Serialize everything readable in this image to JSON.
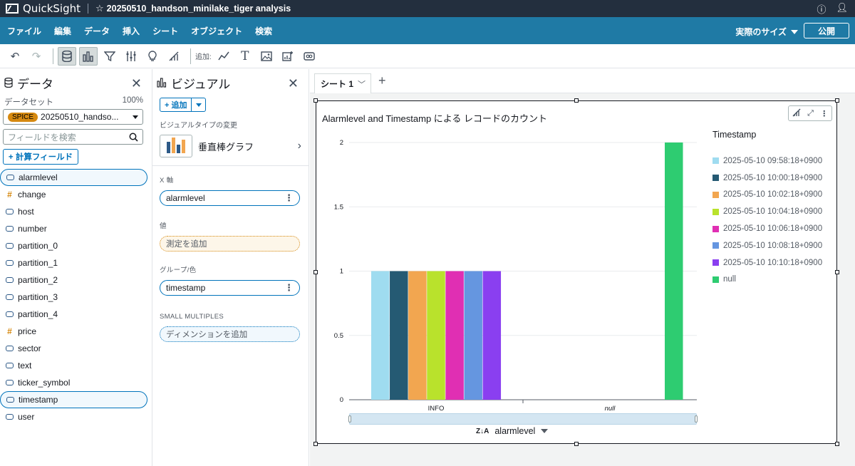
{
  "app": {
    "name": "QuickSight",
    "analysis_title": "20250510_handson_minilake_tiger analysis"
  },
  "menu": {
    "items": [
      "ファイル",
      "編集",
      "データ",
      "挿入",
      "シート",
      "オブジェクト",
      "検索"
    ],
    "size_label": "実際のサイズ",
    "publish_label": "公開"
  },
  "toolbar": {
    "add_label": "追加:"
  },
  "data_panel": {
    "title": "データ",
    "dataset_label": "データセット",
    "dataset_percent": "100%",
    "spice_badge": "SPICE",
    "dataset_name": "20250510_handso...",
    "search_placeholder": "フィールドを検索",
    "calc_field_label": "+ 計算フィールド",
    "fields": [
      {
        "name": "alarmlevel",
        "type": "dimension",
        "selected": true
      },
      {
        "name": "change",
        "type": "measure",
        "selected": false
      },
      {
        "name": "host",
        "type": "dimension",
        "selected": false
      },
      {
        "name": "number",
        "type": "dimension",
        "selected": false
      },
      {
        "name": "partition_0",
        "type": "dimension",
        "selected": false
      },
      {
        "name": "partition_1",
        "type": "dimension",
        "selected": false
      },
      {
        "name": "partition_2",
        "type": "dimension",
        "selected": false
      },
      {
        "name": "partition_3",
        "type": "dimension",
        "selected": false
      },
      {
        "name": "partition_4",
        "type": "dimension",
        "selected": false
      },
      {
        "name": "price",
        "type": "measure",
        "selected": false
      },
      {
        "name": "sector",
        "type": "dimension",
        "selected": false
      },
      {
        "name": "text",
        "type": "dimension",
        "selected": false
      },
      {
        "name": "ticker_symbol",
        "type": "dimension",
        "selected": false
      },
      {
        "name": "timestamp",
        "type": "dimension",
        "selected": true
      },
      {
        "name": "user",
        "type": "dimension",
        "selected": false
      }
    ]
  },
  "visual_panel": {
    "title": "ビジュアル",
    "add_label": "+ 追加",
    "change_type_label": "ビジュアルタイプの変更",
    "visual_type": "垂直棒グラフ",
    "x_axis_label": "X 軸",
    "x_axis_field": "alarmlevel",
    "value_label": "値",
    "value_placeholder": "測定を追加",
    "group_label": "グループ/色",
    "group_field": "timestamp",
    "small_multiples_label": "SMALL MULTIPLES",
    "small_multiples_placeholder": "ディメンションを追加"
  },
  "sheet": {
    "tab_label": "シート 1"
  },
  "visual": {
    "title": "Alarmlevel and Timestamp による レコードのカウント",
    "x_field_label": "alarmlevel"
  },
  "chart_data": {
    "type": "bar",
    "title": "Alarmlevel and Timestamp による レコードのカウント",
    "xlabel": "alarmlevel",
    "ylabel": "",
    "ylim": [
      0,
      2
    ],
    "yticks": [
      "0",
      "0.5",
      "1",
      "1.5",
      "2"
    ],
    "categories": [
      "INFO",
      "null"
    ],
    "legend_title": "Timestamp",
    "legend_position": "right",
    "series": [
      {
        "name": "2025-05-10 09:58:18+0900",
        "color": "#9fdcf0",
        "values": [
          1,
          0
        ]
      },
      {
        "name": "2025-05-10 10:00:18+0900",
        "color": "#255a73",
        "values": [
          1,
          0
        ]
      },
      {
        "name": "2025-05-10 10:02:18+0900",
        "color": "#f2a650",
        "values": [
          1,
          0
        ]
      },
      {
        "name": "2025-05-10 10:04:18+0900",
        "color": "#b9e22c",
        "values": [
          1,
          0
        ]
      },
      {
        "name": "2025-05-10 10:06:18+0900",
        "color": "#e02fb3",
        "values": [
          1,
          0
        ]
      },
      {
        "name": "2025-05-10 10:08:18+0900",
        "color": "#6596e0",
        "values": [
          1,
          0
        ]
      },
      {
        "name": "2025-05-10 10:10:18+0900",
        "color": "#8a3ff0",
        "values": [
          1,
          0
        ]
      },
      {
        "name": "null",
        "color": "#2ecc71",
        "values": [
          0,
          2
        ]
      }
    ]
  }
}
